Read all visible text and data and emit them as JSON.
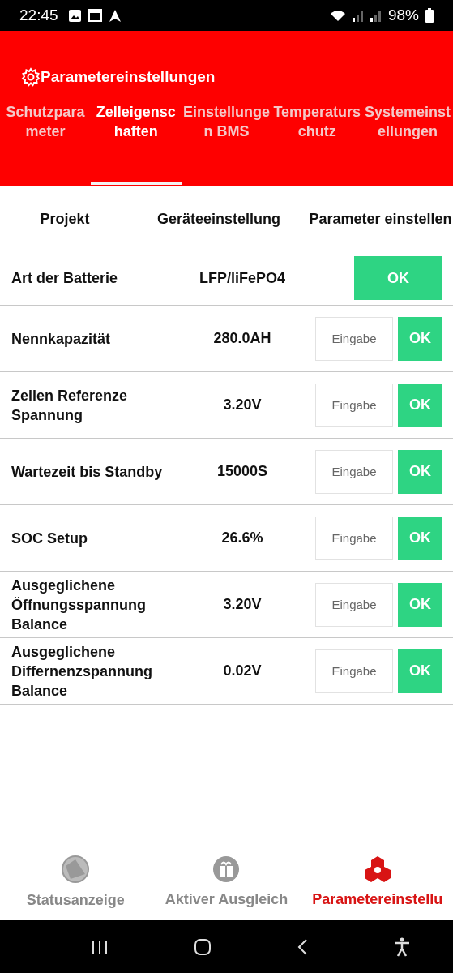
{
  "status_bar": {
    "time": "22:45",
    "battery": "98%"
  },
  "header": {
    "title": "Parametereinstellungen"
  },
  "tabs": [
    {
      "label": "Schutzparameter",
      "selected": false
    },
    {
      "label": "Zelleigenschaften",
      "selected": true
    },
    {
      "label": "Einstellungen BMS",
      "selected": false
    },
    {
      "label": "Temperaturschutz",
      "selected": false
    },
    {
      "label": "Systemeinstellungen",
      "selected": false
    }
  ],
  "table": {
    "columns": [
      "Projekt",
      "Geräteeinstellung",
      "Parameter einstellen"
    ],
    "rows": [
      {
        "kind": "select",
        "label": "Art der Batterie",
        "value": "LFP/liFePO4",
        "button": "OK"
      },
      {
        "kind": "input",
        "label": "Nennkapazität",
        "value": "280.0AH",
        "placeholder": "Eingabe",
        "button": "OK"
      },
      {
        "kind": "input",
        "label": "Zellen Referenze Spannung",
        "value": "3.20V",
        "placeholder": "Eingabe",
        "button": "OK"
      },
      {
        "kind": "input",
        "label": "Wartezeit bis Standby",
        "value": "15000S",
        "placeholder": "Eingabe",
        "button": "OK"
      },
      {
        "kind": "input",
        "label": "SOC Setup",
        "value": "26.6%",
        "placeholder": "Eingabe",
        "button": "OK"
      },
      {
        "kind": "input",
        "label": "Ausgeglichene Öffnungsspannung Balance",
        "value": "3.20V",
        "placeholder": "Eingabe",
        "button": "OK"
      },
      {
        "kind": "input",
        "label": "Ausgeglichene Differnenzspannung Balance",
        "value": "0.02V",
        "placeholder": "Eingabe",
        "button": "OK"
      }
    ]
  },
  "bottom_nav": [
    {
      "label": "Statusanzeige",
      "selected": false
    },
    {
      "label": "Aktiver Ausgleich",
      "selected": false
    },
    {
      "label": "Parametereinstellu",
      "selected": true
    }
  ]
}
